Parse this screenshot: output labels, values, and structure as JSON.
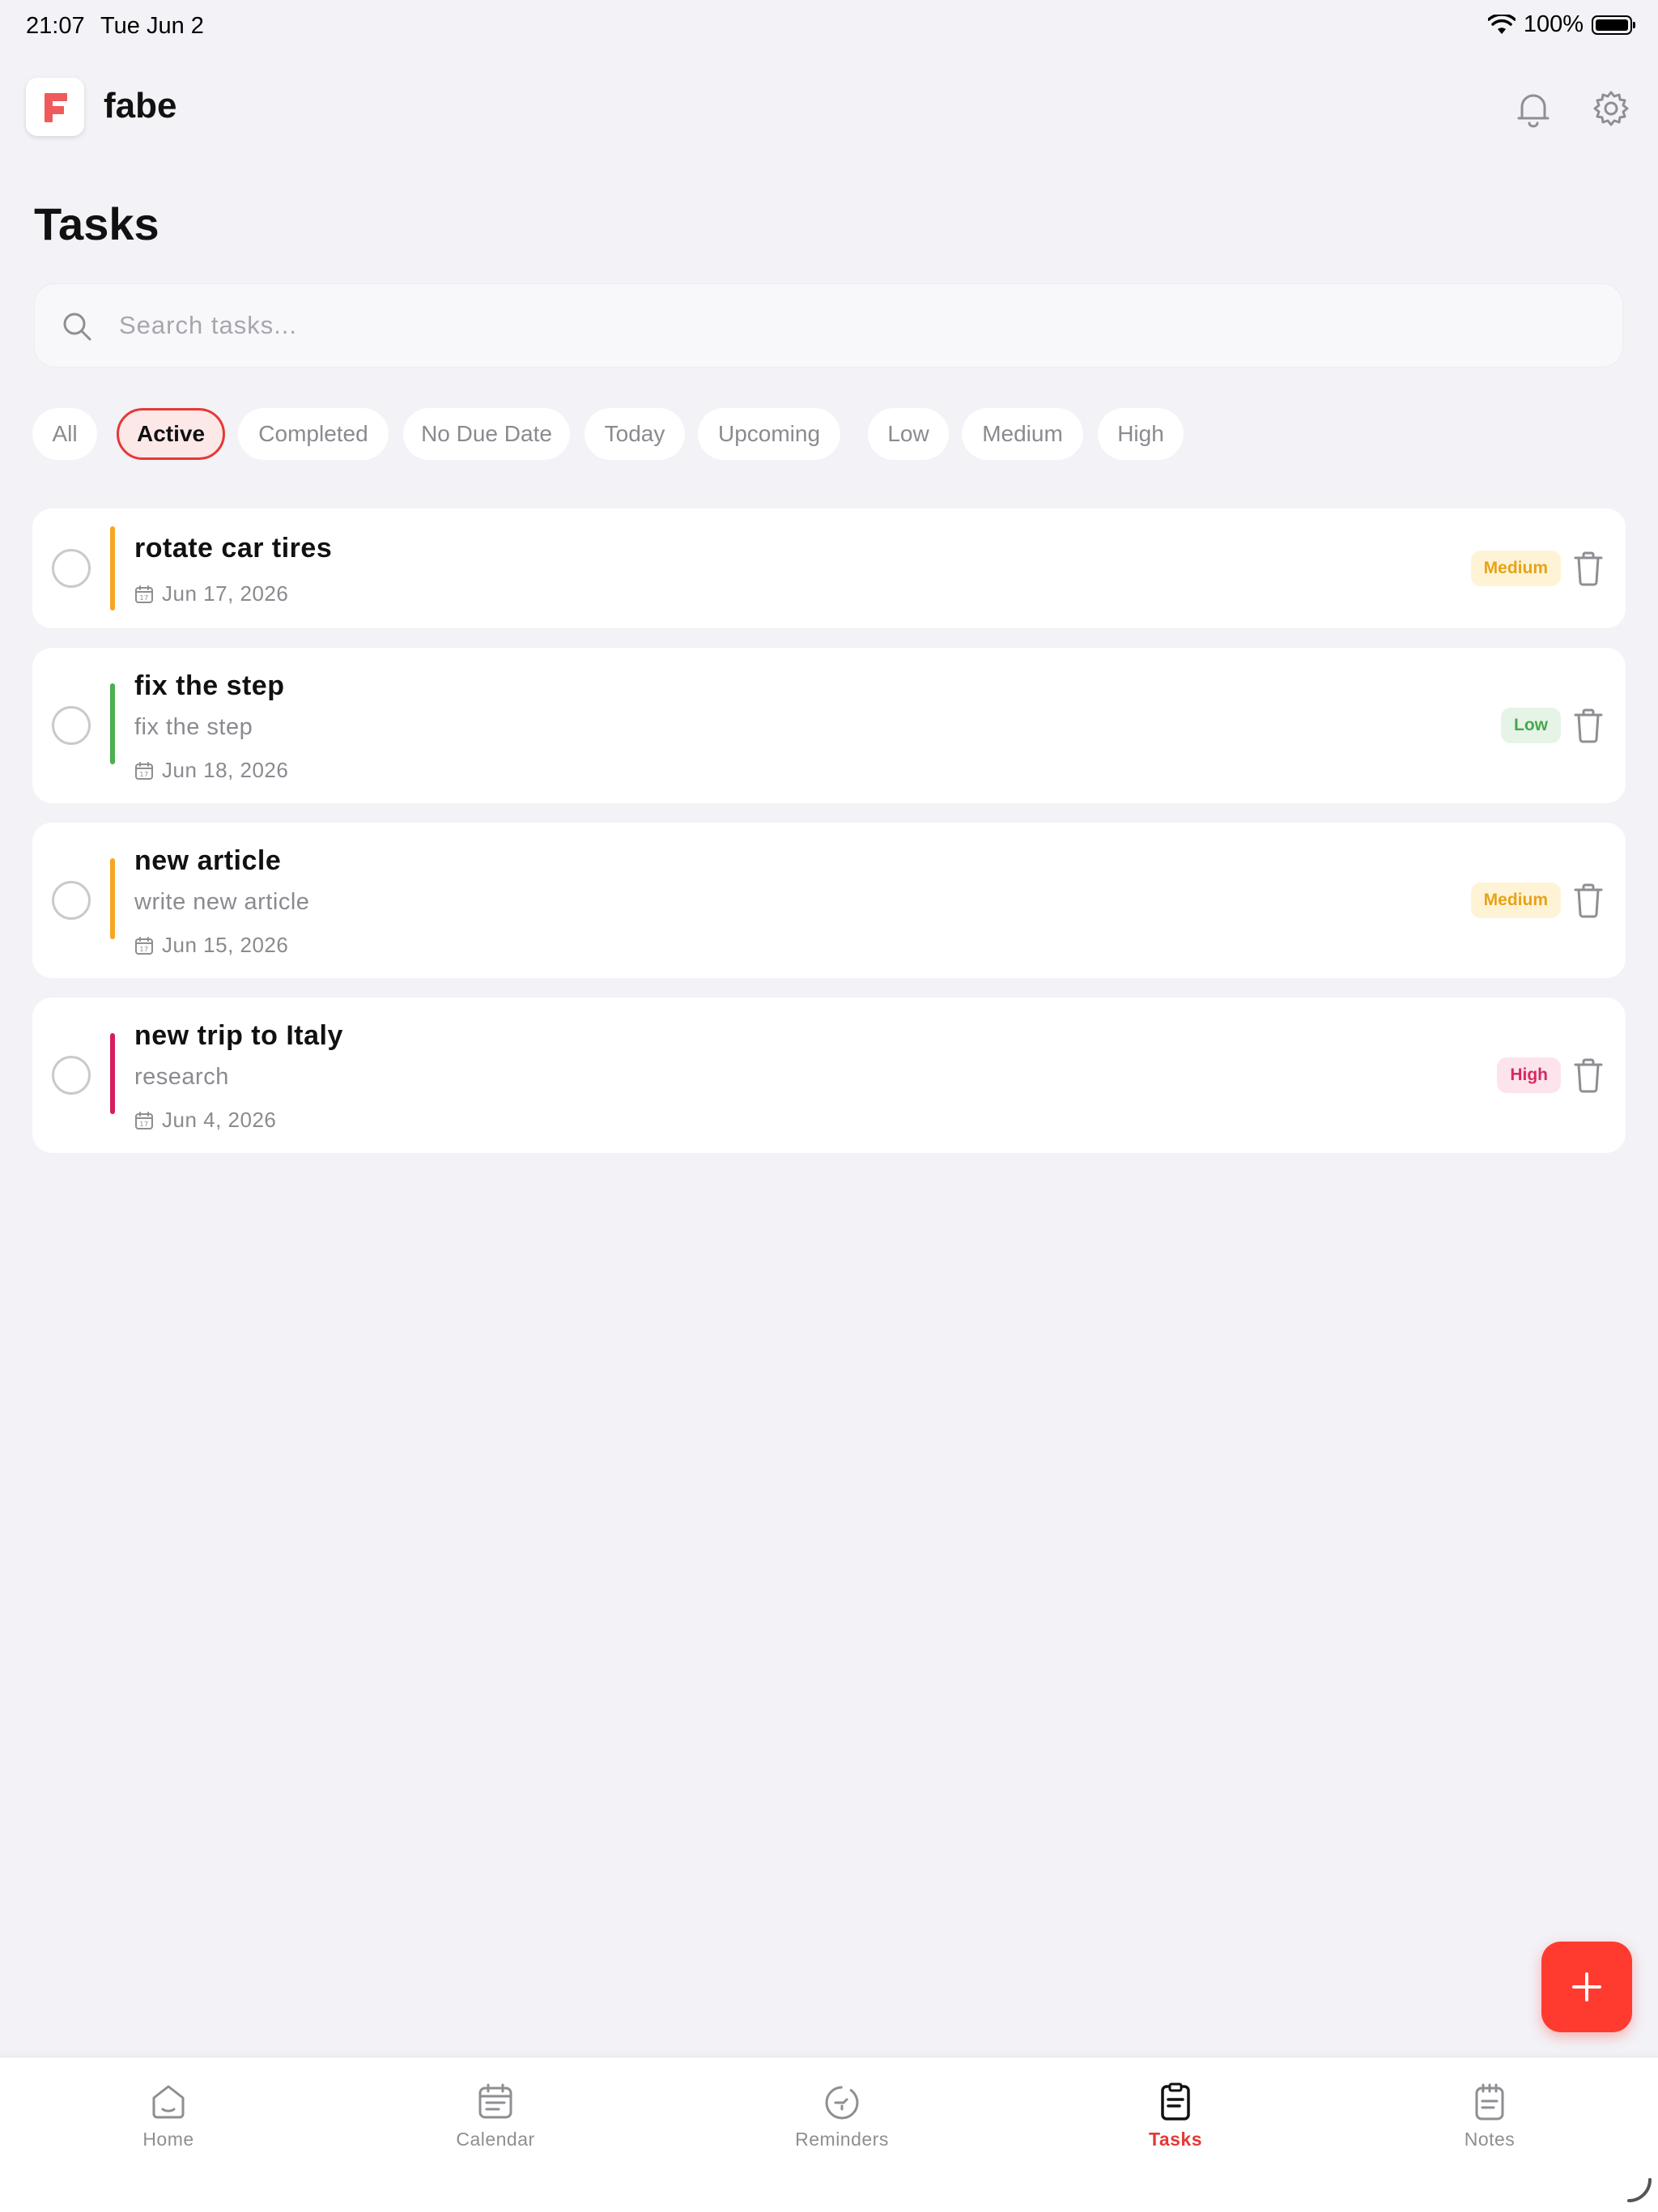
{
  "status_bar": {
    "time": "21:07",
    "date": "Tue Jun 2",
    "battery": "100%"
  },
  "header": {
    "app_name": "fabe",
    "logo_letter": "F"
  },
  "page": {
    "title": "Tasks"
  },
  "search": {
    "placeholder": "Search tasks...",
    "value": ""
  },
  "filters": [
    {
      "label": "All",
      "active": false
    },
    {
      "label": "Active",
      "active": true
    },
    {
      "label": "Completed",
      "active": false
    },
    {
      "label": "No Due Date",
      "active": false
    },
    {
      "label": "Today",
      "active": false
    },
    {
      "label": "Upcoming",
      "active": false
    },
    {
      "label": "Low",
      "active": false
    },
    {
      "label": "Medium",
      "active": false
    },
    {
      "label": "High",
      "active": false
    }
  ],
  "tasks": [
    {
      "title": "rotate car tires",
      "description": "",
      "due": "Jun 17, 2026",
      "priority": "Medium",
      "color": "#f5a623"
    },
    {
      "title": "fix the step",
      "description": "fix the step",
      "due": "Jun 18, 2026",
      "priority": "Low",
      "color": "#4caf50"
    },
    {
      "title": "new article",
      "description": "write new article",
      "due": "Jun 15, 2026",
      "priority": "Medium",
      "color": "#f5a623"
    },
    {
      "title": "new trip to Italy",
      "description": "research",
      "due": "Jun 4, 2026",
      "priority": "High",
      "color": "#d81b60"
    }
  ],
  "tab_bar": [
    {
      "label": "Home",
      "icon": "home-icon",
      "active": false
    },
    {
      "label": "Calendar",
      "icon": "calendar-icon",
      "active": false
    },
    {
      "label": "Reminders",
      "icon": "reminders-icon",
      "active": false
    },
    {
      "label": "Tasks",
      "icon": "tasks-icon",
      "active": true
    },
    {
      "label": "Notes",
      "icon": "notes-icon",
      "active": false
    }
  ],
  "colors": {
    "accent": "#e53935",
    "fab": "#ff3b30",
    "background": "#f2f2f7"
  }
}
